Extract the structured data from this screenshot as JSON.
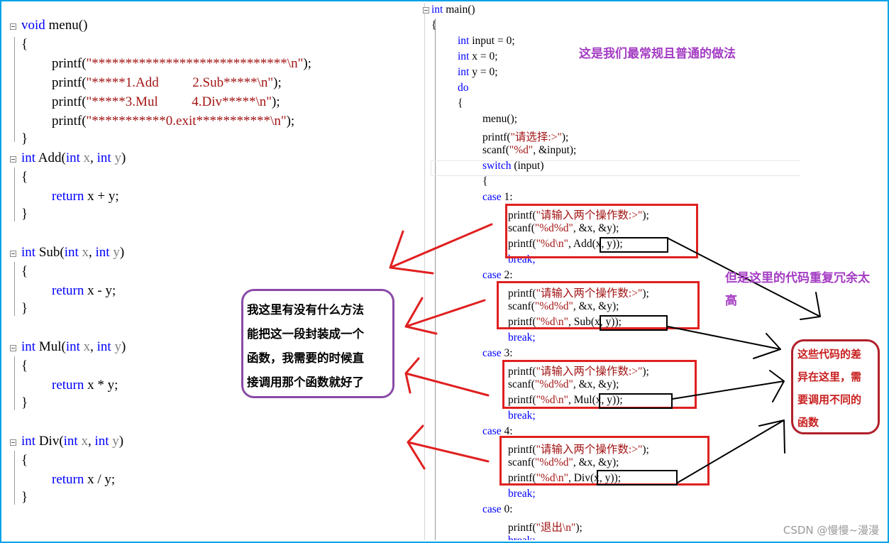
{
  "left_code": {
    "menu_sig": [
      "void",
      " menu()"
    ],
    "lbrace": "{",
    "rbrace": "}",
    "printf": "printf(",
    "menu_strings": [
      "\"*****************************\\n\"",
      "\"*****1.Add          2.Sub*****\\n\"",
      "\"*****3.Mul          4.Div*****\\n\"",
      "\"***********0.exit***********\\n\""
    ],
    "close_paren_semi": ");",
    "funcs": [
      {
        "name": " Add(",
        "body": " x + y;"
      },
      {
        "name": " Sub(",
        "body": " x - y;"
      },
      {
        "name": " Mul(",
        "body": " x * y;"
      },
      {
        "name": " Div(",
        "body": " x / y;"
      }
    ],
    "kw_int": "int",
    "kw_return": "return",
    "param_x": " x",
    "comma": ", ",
    "param_y": " y",
    "rparen": ")"
  },
  "right_code": {
    "main_sig": [
      " main()"
    ],
    "decls": [
      " input = 0;",
      " x = 0;",
      " y = 0;"
    ],
    "kw_do": "do",
    "menu_call": "menu();",
    "prompt_printf": [
      "printf(",
      "\"请选择:>\"",
      ");"
    ],
    "scanf_input": [
      "scanf(",
      "\"%d\"",
      ", &input);"
    ],
    "switch_line": [
      "switch",
      " (input)"
    ],
    "cases": [
      {
        "label": " 1:",
        "op": "Add(x, y)"
      },
      {
        "label": " 2:",
        "op": "Sub(x, y)"
      },
      {
        "label": " 3:",
        "op": "Mul(x, y)"
      },
      {
        "label": " 4:",
        "op": "Div(x, y)"
      }
    ],
    "kw_case": "case",
    "ask_operands": "\"请输入两个操作数:>\"",
    "scanf_fmt": "\"%d%d\"",
    "scanf_args": ", &x, &y);",
    "print_fmt": "\"%d\\n\"",
    "comma_sp": ", ",
    "close": ");",
    "kw_break": "break;",
    "case0": " 0:",
    "exit_str": "\"退出\\n\"",
    "break_partial": "break;"
  },
  "annotations": {
    "top_note": "这是我们最常规且普通的做法",
    "redundant_note": "但是这里的代码重复冗余太高",
    "question_bubble": [
      "我这里有没有什么方法",
      "能把这一段封装成一个",
      "函数，我需要的时候直",
      "接调用那个函数就好了"
    ],
    "diff_bubble": [
      "这些代码的差",
      "异在这里，需",
      "要调用不同的",
      "函数"
    ]
  },
  "watermark": "CSDN @慢慢~漫漫",
  "colors": {
    "keyword": "#0000ff",
    "string": "#a31515",
    "annotation": "#a43cc3",
    "box": "#e02020",
    "frame": "#00a2e8"
  }
}
